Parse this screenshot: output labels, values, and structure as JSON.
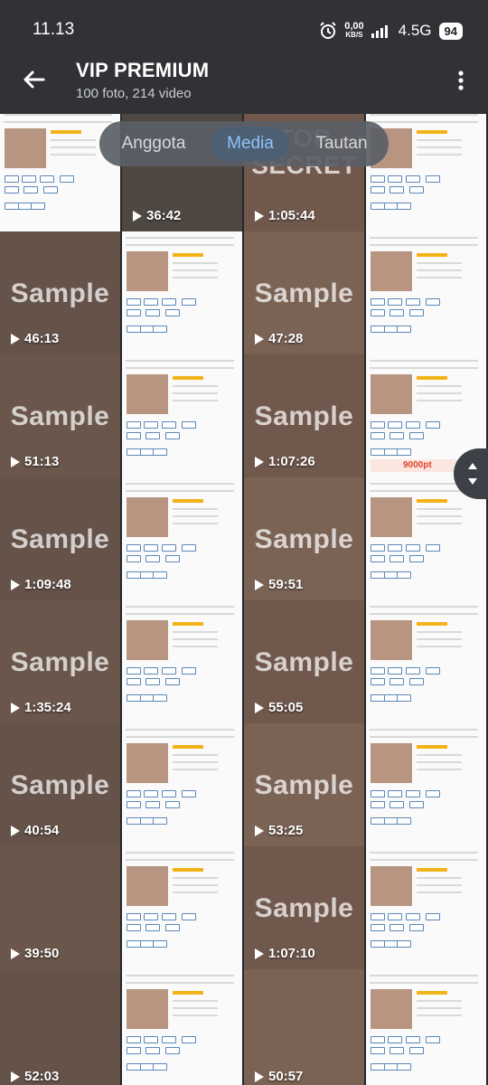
{
  "status_bar": {
    "time": "11.13",
    "speed_value": "0,00",
    "speed_unit": "KB/S",
    "network": "4.5G",
    "battery": "94",
    "icons": [
      "alarm-icon",
      "signal-icon"
    ]
  },
  "header": {
    "title": "VIP PREMIUM",
    "subtitle": "100 foto, 214 video"
  },
  "tabs": [
    {
      "label": "Anggota",
      "active": false
    },
    {
      "label": "Media",
      "active": true
    },
    {
      "label": "Tautan",
      "active": false
    }
  ],
  "tiles": [
    {
      "kind": "ad",
      "duration": ""
    },
    {
      "kind": "photo",
      "duration": "36:42",
      "watermark": ""
    },
    {
      "kind": "photo",
      "duration": "1:05:44",
      "watermark": "TOP SECRET"
    },
    {
      "kind": "ad",
      "duration": ""
    },
    {
      "kind": "photo",
      "duration": "46:13",
      "watermark": "Sample"
    },
    {
      "kind": "ad",
      "duration": ""
    },
    {
      "kind": "photo",
      "duration": "47:28",
      "watermark": "Sample"
    },
    {
      "kind": "ad",
      "duration": ""
    },
    {
      "kind": "photo",
      "duration": "51:13",
      "watermark": "Sample"
    },
    {
      "kind": "ad",
      "duration": ""
    },
    {
      "kind": "photo",
      "duration": "1:07:26",
      "watermark": "Sample"
    },
    {
      "kind": "ad",
      "duration": "",
      "price": "9000pt"
    },
    {
      "kind": "photo",
      "duration": "1:09:48",
      "watermark": "Sample"
    },
    {
      "kind": "ad",
      "duration": ""
    },
    {
      "kind": "photo",
      "duration": "59:51",
      "watermark": "Sample"
    },
    {
      "kind": "ad",
      "duration": ""
    },
    {
      "kind": "photo",
      "duration": "1:35:24",
      "watermark": "Sample"
    },
    {
      "kind": "ad",
      "duration": ""
    },
    {
      "kind": "photo",
      "duration": "55:05",
      "watermark": "Sample"
    },
    {
      "kind": "ad",
      "duration": ""
    },
    {
      "kind": "photo",
      "duration": "40:54",
      "watermark": "Sample"
    },
    {
      "kind": "ad",
      "duration": ""
    },
    {
      "kind": "photo",
      "duration": "53:25",
      "watermark": "Sample"
    },
    {
      "kind": "ad",
      "duration": ""
    },
    {
      "kind": "photo",
      "duration": "39:50",
      "watermark": ""
    },
    {
      "kind": "ad",
      "duration": ""
    },
    {
      "kind": "photo",
      "duration": "1:07:10",
      "watermark": "Sample"
    },
    {
      "kind": "ad",
      "duration": ""
    },
    {
      "kind": "photo",
      "duration": "52:03",
      "watermark": ""
    },
    {
      "kind": "ad",
      "duration": ""
    },
    {
      "kind": "photo",
      "duration": "50:57",
      "watermark": ""
    },
    {
      "kind": "ad",
      "duration": ""
    }
  ],
  "colors": {
    "background": "#26282c",
    "app_bar": "#303236",
    "tab_active_bg": "#4d5f73",
    "tab_active_text": "#8fc3f7",
    "tab_inactive_text": "#d7d9dd"
  }
}
